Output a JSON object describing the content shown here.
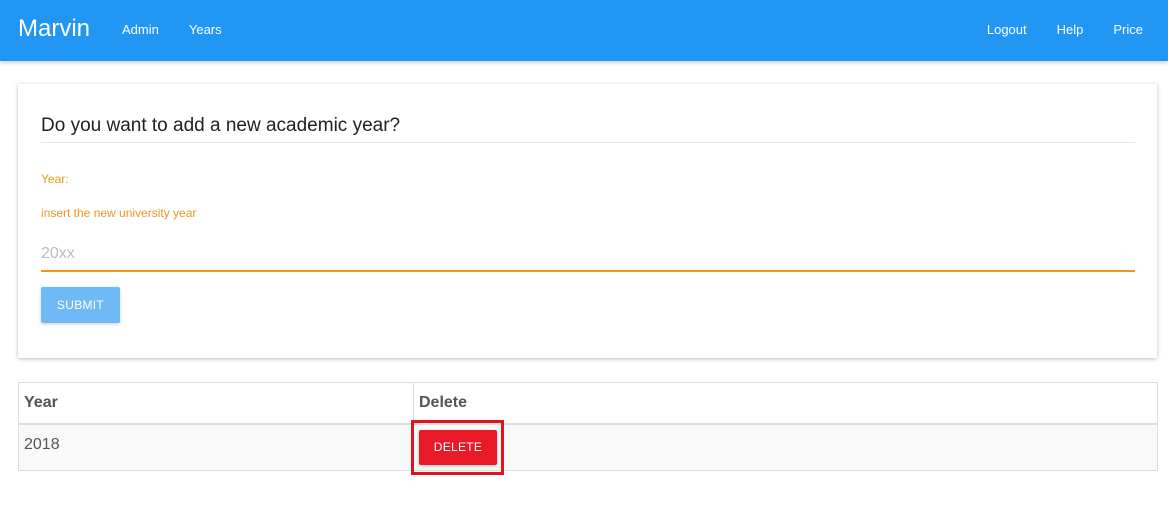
{
  "navbar": {
    "brand": "Marvin",
    "left_links": [
      "Admin",
      "Years"
    ],
    "right_links": [
      "Logout",
      "Help",
      "Price"
    ],
    "color": "#2196f3"
  },
  "form": {
    "title": "Do you want to add a new academic year?",
    "year_label": "Year:",
    "year_help": "insert the new university year",
    "year_placeholder": "20xx",
    "year_value": "",
    "submit_label": "SUBMIT",
    "label_color": "#f0961e"
  },
  "table": {
    "headers": [
      "Year",
      "Delete"
    ],
    "rows": [
      {
        "year": "2018",
        "delete_label": "DELETE"
      }
    ],
    "delete_color": "#e81a28"
  }
}
